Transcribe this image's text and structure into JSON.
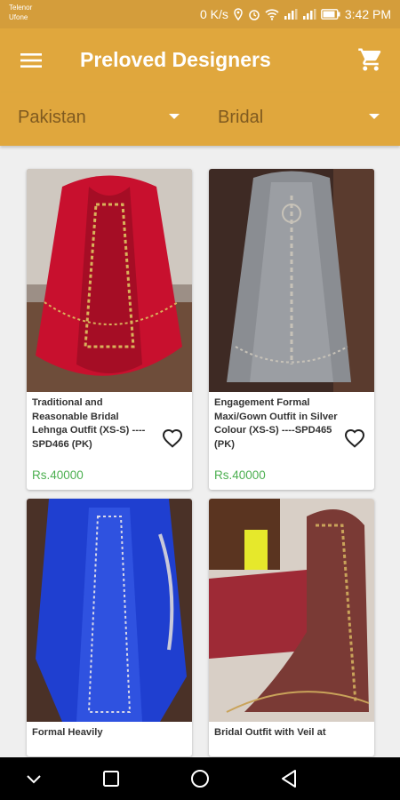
{
  "status_bar": {
    "carrier_1": "Telenor",
    "carrier_2": "Ufone",
    "speed": "0 K/s",
    "time": "3:42 PM"
  },
  "app_bar": {
    "title": "Preloved Designers",
    "menu_icon": "menu-icon",
    "cart_icon": "cart-icon"
  },
  "filters": {
    "country": "Pakistan",
    "category": "Bridal"
  },
  "products": [
    {
      "name": "Traditional and Reasonable Bridal Lehnga Outfit (XS-S) ----SPD466 (PK)",
      "price": "Rs.40000",
      "dress_color": "#c8102e"
    },
    {
      "name": "Engagement Formal Maxi/Gown Outfit in Silver Colour (XS-S) ----SPD465 (PK)",
      "price": "Rs.40000",
      "dress_color": "#8a8d92"
    },
    {
      "name": "Formal Heavily",
      "price": "",
      "dress_color": "#1f3fd0"
    },
    {
      "name": "Bridal Outfit with Veil at",
      "price": "",
      "dress_color": "#7a3a35"
    }
  ],
  "colors": {
    "app_bar": "#e0a73d",
    "price": "#4caf50"
  }
}
